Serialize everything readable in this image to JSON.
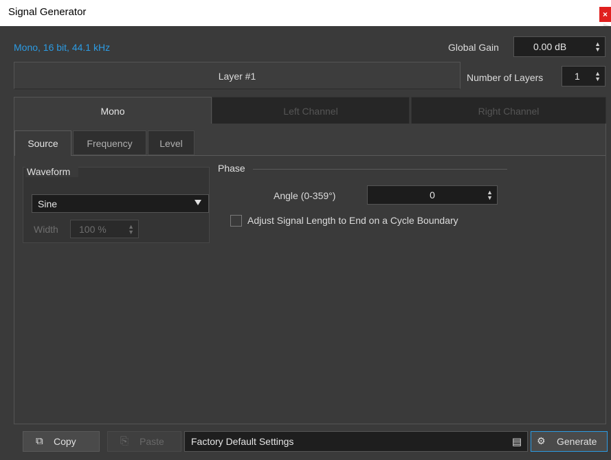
{
  "window": {
    "title": "Signal Generator",
    "close_glyph": "×"
  },
  "header": {
    "format_info": "Mono, 16 bit, 44.1 kHz",
    "global_gain_label": "Global Gain",
    "global_gain_value": "0.00 dB",
    "layer_tab_label": "Layer #1",
    "number_of_layers_label": "Number of Layers",
    "number_of_layers_value": "1"
  },
  "channel_tabs": [
    {
      "label": "Mono",
      "active": true
    },
    {
      "label": "Left Channel",
      "active": false
    },
    {
      "label": "Right Channel",
      "active": false
    }
  ],
  "sub_tabs": [
    {
      "label": "Source",
      "active": true
    },
    {
      "label": "Frequency",
      "active": false
    },
    {
      "label": "Level",
      "active": false
    }
  ],
  "source": {
    "waveform_title": "Waveform",
    "waveform_value": "Sine",
    "width_label": "Width",
    "width_value": "100 %",
    "phase_title": "Phase",
    "angle_label": "Angle (0-359°)",
    "angle_value": "0",
    "adjust_label": "Adjust Signal Length to End on a Cycle Boundary",
    "adjust_checked": false
  },
  "footer": {
    "copy_label": "Copy",
    "paste_label": "Paste",
    "preset_name": "Factory Default Settings",
    "generate_label": "Generate"
  },
  "colors": {
    "accent": "#2c9be3",
    "close_button": "#e0201f",
    "dialog_background": "#3a3a3a"
  },
  "icons": {
    "copy": "copy-icon",
    "paste": "paste-icon",
    "preset_menu": "preset-menu-icon",
    "generate": "gears-icon",
    "spin_arrows": "spin-arrows-icon",
    "dropdown": "chevron-down-icon"
  }
}
